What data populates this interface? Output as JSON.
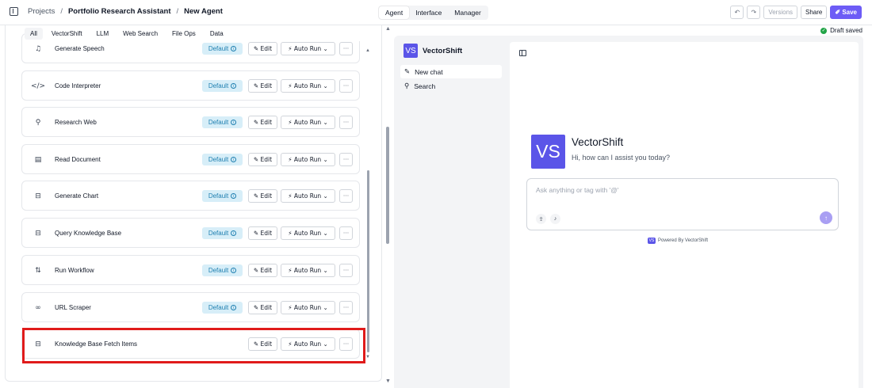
{
  "breadcrumb": {
    "project": "Projects",
    "folder": "Portfolio Research Assistant",
    "page": "New Agent"
  },
  "mode_tabs": [
    "Agent",
    "Interface",
    "Manager"
  ],
  "toolbar": {
    "undo": "↶",
    "redo": "↷",
    "versions": "Versions",
    "share": "Share",
    "save": "Save",
    "save_icon": "✐"
  },
  "status": {
    "draft": "Draft saved"
  },
  "filters": [
    "All",
    "VectorShift",
    "LLM",
    "Web Search",
    "File Ops",
    "Data"
  ],
  "tools": [
    {
      "name": "Generate Speech",
      "icon": "sound-wave-icon",
      "glyph": "♫",
      "badge": "Default"
    },
    {
      "name": "Code Interpreter",
      "icon": "code-icon",
      "glyph": "</>",
      "badge": "Default"
    },
    {
      "name": "Research Web",
      "icon": "search-icon",
      "glyph": "⚲",
      "badge": "Default"
    },
    {
      "name": "Read Document",
      "icon": "document-icon",
      "glyph": "▤",
      "badge": "Default"
    },
    {
      "name": "Generate Chart",
      "icon": "chart-box-icon",
      "glyph": "⊟",
      "badge": "Default"
    },
    {
      "name": "Query Knowledge Base",
      "icon": "knowledge-base-icon",
      "glyph": "⊟",
      "badge": "Default"
    },
    {
      "name": "Run Workflow",
      "icon": "workflow-icon",
      "glyph": "⇅",
      "badge": "Default"
    },
    {
      "name": "URL Scraper",
      "icon": "link-icon",
      "glyph": "∞",
      "badge": "Default"
    },
    {
      "name": "Knowledge Base Fetch Items",
      "icon": "knowledge-base-icon",
      "glyph": "⊟",
      "badge": ""
    }
  ],
  "tool_actions": {
    "badge_info": "i",
    "edit": "✎ Edit",
    "auto_run": "⚡ Auto Run ⌄",
    "more": "···"
  },
  "chat": {
    "brand": "VectorShift",
    "logo": "VS",
    "nav": [
      {
        "label": "New chat",
        "glyph": "✎"
      },
      {
        "label": "Search",
        "glyph": "⚲"
      }
    ],
    "greeting_title": "VectorShift",
    "greeting_sub": "Hi, how can I assist you today?",
    "input_placeholder": "Ask anything or tag with '@'",
    "upload_glyph": "⇪",
    "mic_glyph": "♪",
    "send_glyph": "↑",
    "powered_by": "Powered By VectorShift"
  },
  "colors": {
    "accent": "#6d5cf6",
    "badge_bg": "#d7eef8",
    "highlight": "#e01b1b",
    "success": "#22a447"
  }
}
